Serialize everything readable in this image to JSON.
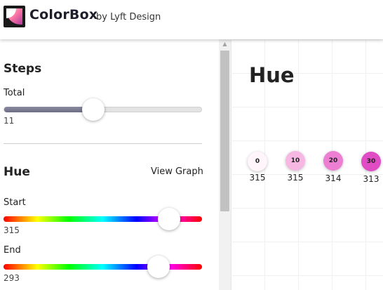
{
  "header": {
    "brand": "ColorBox",
    "byline": "by Lyft Design"
  },
  "sidebar": {
    "steps": {
      "title": "Steps",
      "total_label": "Total",
      "total_value": "11",
      "total_slider_fraction": 0.45
    },
    "hue": {
      "title": "Hue",
      "view_graph": "View Graph",
      "start_label": "Start",
      "start_value": "315",
      "start_slider_fraction": 0.83,
      "end_label": "End",
      "end_value": "293",
      "end_slider_fraction": 0.78
    }
  },
  "main": {
    "title": "Hue",
    "swatches": [
      {
        "step": "0",
        "hue": "315",
        "color": "#fff5fb"
      },
      {
        "step": "10",
        "hue": "315",
        "color": "#f7b7e3"
      },
      {
        "step": "20",
        "hue": "314",
        "color": "#ec7fd2"
      },
      {
        "step": "30",
        "hue": "313",
        "color": "#df4cc3"
      }
    ]
  }
}
